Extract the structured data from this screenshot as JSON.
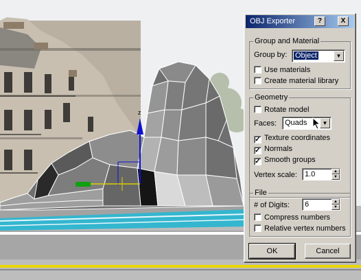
{
  "dialog": {
    "title": "OBJ Exporter",
    "help_label": "?",
    "close_label": "X",
    "group_material": {
      "legend": "Group and Material",
      "group_by_label": "Group by:",
      "group_by_value": "Object",
      "use_materials_label": "Use materials",
      "use_materials_checked": false,
      "create_library_label": "Create material library",
      "create_library_checked": false
    },
    "geometry": {
      "legend": "Geometry",
      "rotate_label": "Rotate model",
      "rotate_checked": false,
      "faces_label": "Faces:",
      "faces_value": "Quads",
      "texcoords_label": "Texture coordinates",
      "texcoords_checked": true,
      "normals_label": "Normals",
      "normals_checked": true,
      "smooth_label": "Smooth groups",
      "smooth_checked": true,
      "vertex_scale_label": "Vertex scale:",
      "vertex_scale_value": "1.0"
    },
    "file": {
      "legend": "File",
      "digits_label": "# of Digits:",
      "digits_value": "6",
      "compress_label": "Compress numbers",
      "compress_checked": false,
      "relative_label": "Relative vertex numbers",
      "relative_checked": false
    },
    "ok_label": "OK",
    "cancel_label": "Cancel"
  },
  "viewport": {
    "gizmo_axis_label": "z",
    "colors": {
      "sky": "#eef0f2",
      "mesh": "#6f6f6f",
      "pool": "#34b6cf",
      "gizmo_z": "#1010d0",
      "gizmo_x": "#d8d000",
      "gizmo_y": "#10a010",
      "timeline": "#e8d800"
    }
  }
}
